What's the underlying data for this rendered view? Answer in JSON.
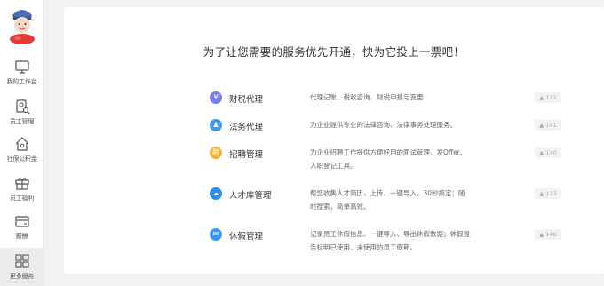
{
  "sidebar": {
    "items": [
      {
        "label": "我的工作台",
        "icon": "monitor-icon"
      },
      {
        "label": "员工管理",
        "icon": "employee-icon"
      },
      {
        "label": "社保公积金",
        "icon": "home-icon"
      },
      {
        "label": "员工福利",
        "icon": "gift-icon"
      },
      {
        "label": "薪酬",
        "icon": "wallet-icon"
      },
      {
        "label": "更多服务",
        "icon": "grid-icon"
      }
    ]
  },
  "main": {
    "headline": "为了让您需要的服务优先开通，快为它投上一票吧！",
    "services": [
      {
        "name": "财税代理",
        "desc": "代理记账、税收咨询、财税申报与变更",
        "votes": "▲ 122",
        "icon": "coin-icon",
        "color": "#7a7de6"
      },
      {
        "name": "法务代理",
        "desc": "为企业提供专业的法律咨询、法律事务处理服务。",
        "votes": "▲ 141",
        "icon": "person-icon",
        "color": "#3b9be8"
      },
      {
        "name": "招聘管理",
        "desc": "为企业招聘工作提供方便好用的面试管理、发Offer、入职登记工具。",
        "votes": "▲ 140",
        "icon": "recruit-icon",
        "color": "#f5b43b"
      },
      {
        "name": "人才库管理",
        "desc": "帮您收集人才简历，上传、一键导入，30秒搞定；随时搜索，简单高效。",
        "votes": "▲ 133",
        "icon": "cloud-icon",
        "color": "#2f8fe0"
      },
      {
        "name": "休假管理",
        "desc": "记录员工休假信息、一键导入、导出休假数据；休假报告标明已使用、未使用的员工假期。",
        "votes": "▲ 146",
        "icon": "chat-icon",
        "color": "#3b9be8"
      }
    ]
  }
}
